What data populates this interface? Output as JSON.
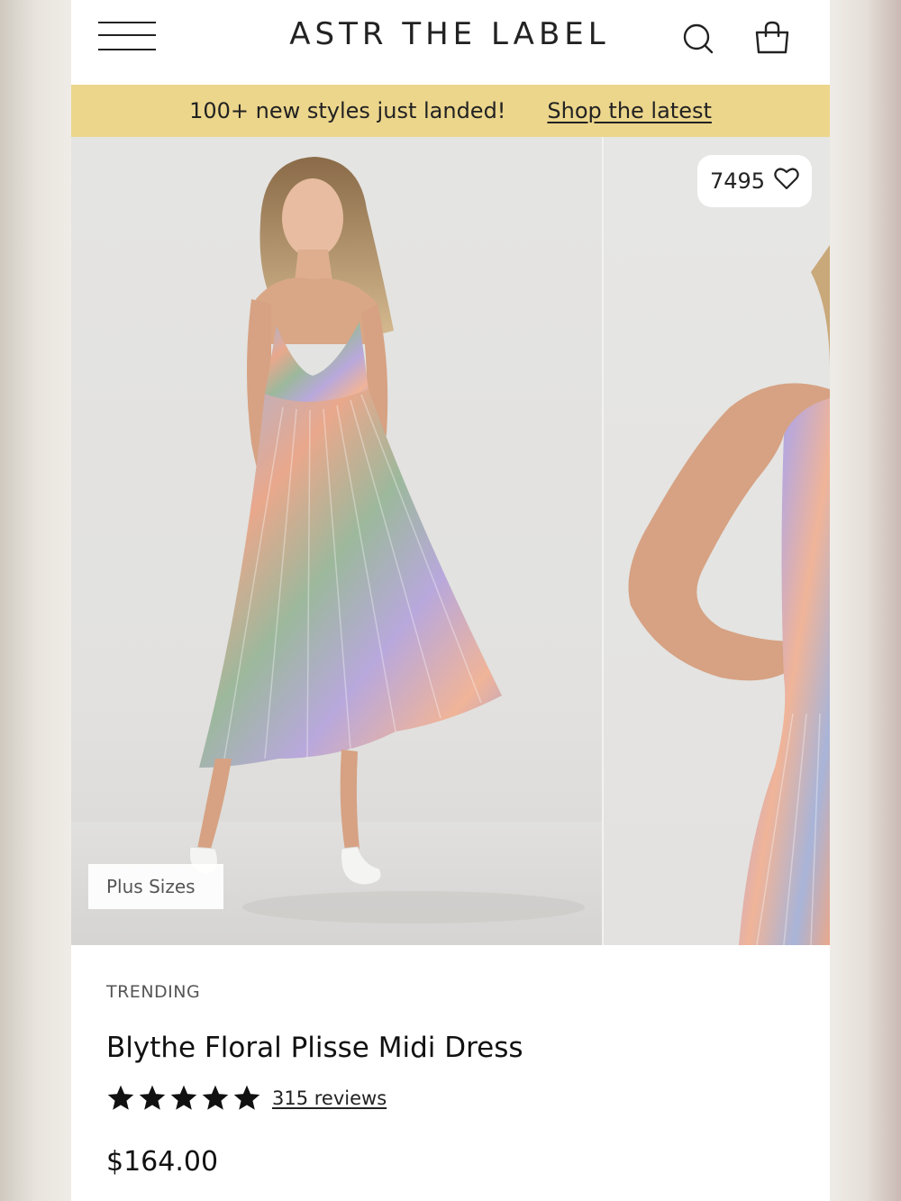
{
  "header": {
    "logo": "ASTR THE LABEL",
    "menu_icon": "hamburger-menu-icon",
    "search_icon": "search-icon",
    "bag_icon": "shopping-bag-icon"
  },
  "banner": {
    "message": "100+ new styles just landed!",
    "link": "Shop the latest",
    "background": "#ecd68c"
  },
  "gallery": {
    "like_count": "7495",
    "like_icon": "heart-icon",
    "size_tag": "Plus Sizes"
  },
  "product": {
    "badge": "TRENDING",
    "name": "Blythe Floral Plisse Midi Dress",
    "rating": 5,
    "rating_max": 5,
    "reviews": "315 reviews",
    "price": "$164.00"
  }
}
